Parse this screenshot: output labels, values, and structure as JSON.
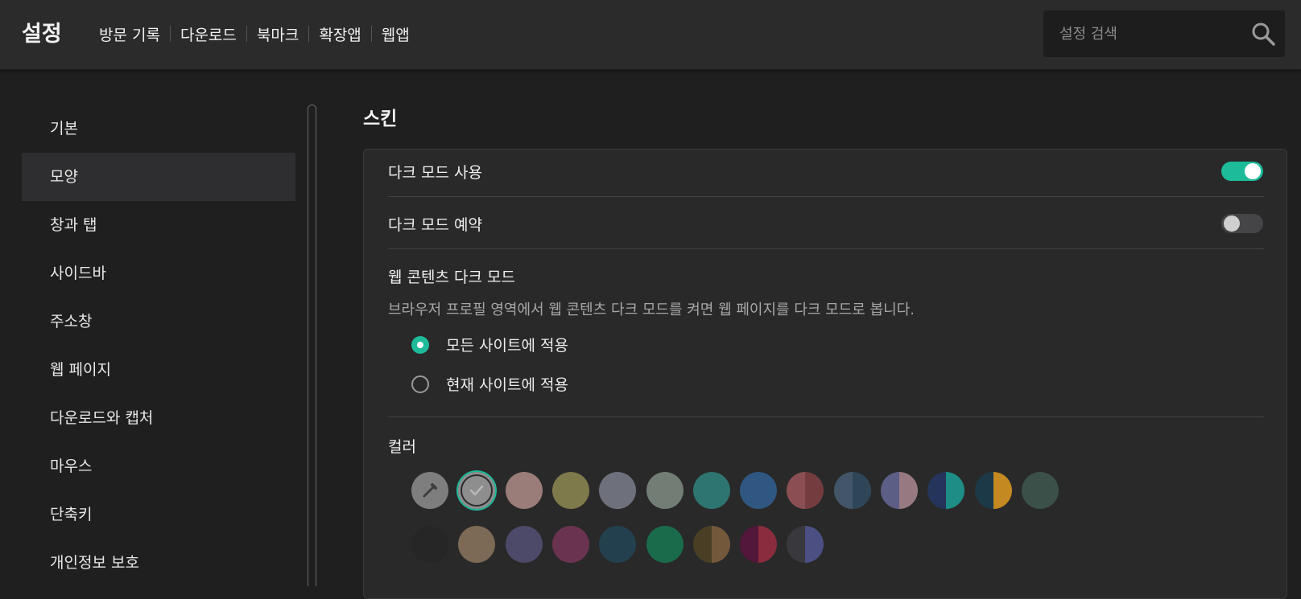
{
  "header": {
    "title": "설정",
    "nav": [
      "방문 기록",
      "다운로드",
      "북마크",
      "확장앱",
      "웹앱"
    ],
    "search_placeholder": "설정 검색"
  },
  "sidebar": {
    "items": [
      "기본",
      "모양",
      "창과 탭",
      "사이드바",
      "주소창",
      "웹 페이지",
      "다운로드와 캡처",
      "마우스",
      "단축키",
      "개인정보 보호"
    ],
    "active_index": 1
  },
  "main": {
    "section_title": "스킨",
    "dark_mode": {
      "label": "다크 모드 사용",
      "enabled": true
    },
    "dark_mode_schedule": {
      "label": "다크 모드 예약",
      "enabled": false
    },
    "web_content_dark": {
      "title": "웹 콘텐츠 다크 모드",
      "description": "브라우저 프로필 영역에서 웹 콘텐츠 다크 모드를 켜면 웹 페이지를 다크 모드로 봅니다.",
      "options": [
        "모든 사이트에 적용",
        "현재 사이트에 적용"
      ],
      "selected_index": 0
    },
    "color": {
      "label": "컬러",
      "selected_index": 1,
      "row1": [
        {
          "left": "#7e7e7e",
          "right": "#7e7e7e",
          "icon": "eyedropper-icon"
        },
        {
          "left": "#8e8e8e",
          "right": "#8e8e8e",
          "icon": "check-icon"
        },
        {
          "left": "#9a7d79",
          "right": "#9a7d79"
        },
        {
          "left": "#7f7a4c",
          "right": "#7f7a4c"
        },
        {
          "left": "#6e717c",
          "right": "#6e717c"
        },
        {
          "left": "#727d76",
          "right": "#727d76"
        },
        {
          "left": "#2e7470",
          "right": "#2e7470"
        },
        {
          "left": "#2f5781",
          "right": "#2f5781"
        },
        {
          "left": "#8b4f53",
          "right": "#753c40"
        },
        {
          "left": "#435669",
          "right": "#2f4658"
        },
        {
          "left": "#5c5e86",
          "right": "#977a81"
        },
        {
          "left": "#25345a",
          "right": "#1d8d86"
        },
        {
          "left": "#1c3948",
          "right": "#c48920"
        },
        {
          "left": "#3a5048",
          "right": "#3a5048"
        }
      ],
      "row2": [
        {
          "left": "#262626",
          "right": "#262626"
        },
        {
          "left": "#7c6a56",
          "right": "#7c6a56"
        },
        {
          "left": "#4c4a68",
          "right": "#4c4a68"
        },
        {
          "left": "#6a3450",
          "right": "#6a3450"
        },
        {
          "left": "#23404e",
          "right": "#23404e"
        },
        {
          "left": "#1a6b4b",
          "right": "#1a6b4b"
        },
        {
          "left": "#4a3f25",
          "right": "#73583c"
        },
        {
          "left": "#52173a",
          "right": "#8a2c3d"
        },
        {
          "left": "#38383d",
          "right": "#4b4f82"
        }
      ]
    }
  }
}
